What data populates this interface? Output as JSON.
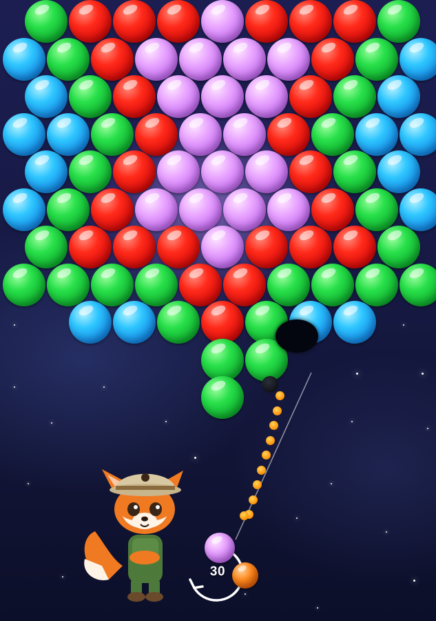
{
  "game": {
    "moves_left": "30",
    "colors": {
      "red": "#e8140f",
      "green": "#14c23a",
      "blue": "#1ea8f5",
      "purple": "#d58cf7",
      "orange": "#ff7a10"
    },
    "grid": {
      "rows": [
        [
          "green",
          "red",
          "red",
          "red",
          "purple",
          "red",
          "red",
          "red",
          "green"
        ],
        [
          "blue",
          "green",
          "red",
          "purple",
          "purple",
          "purple",
          "purple",
          "red",
          "green",
          "blue"
        ],
        [
          "blue",
          "green",
          "red",
          "purple",
          "purple",
          "purple",
          "red",
          "green",
          "blue"
        ],
        [
          "blue",
          "blue",
          "green",
          "red",
          "purple",
          "purple",
          "red",
          "green",
          "blue",
          "blue"
        ],
        [
          "blue",
          "green",
          "red",
          "purple",
          "purple",
          "purple",
          "red",
          "green",
          "blue"
        ],
        [
          "blue",
          "green",
          "red",
          "purple",
          "purple",
          "purple",
          "purple",
          "red",
          "green",
          "blue"
        ],
        [
          "green",
          "red",
          "red",
          "red",
          "purple",
          "red",
          "red",
          "red",
          "green"
        ],
        [
          "green",
          "green",
          "green",
          "green",
          "red",
          "red",
          "green",
          "green",
          "green",
          "green"
        ],
        [
          null,
          "blue",
          "blue",
          "green",
          "red",
          "green",
          "blue",
          "blue"
        ],
        [
          null,
          null,
          null,
          null,
          "green",
          "green"
        ],
        [
          null,
          null,
          null,
          null,
          "green"
        ]
      ]
    },
    "current_bubble": "purple",
    "next_bubble": "orange",
    "mascot": "fox-explorer"
  }
}
